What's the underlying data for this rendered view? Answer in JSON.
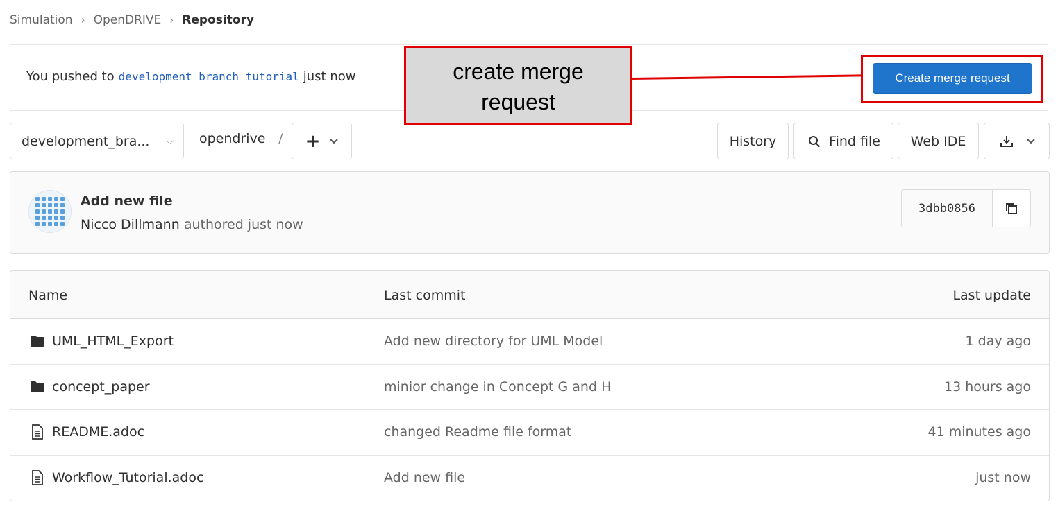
{
  "breadcrumb": {
    "items": [
      "Simulation",
      "OpenDRIVE"
    ],
    "current": "Repository"
  },
  "push_banner": {
    "prefix": "You pushed to",
    "branch": "development_branch_tutorial",
    "suffix": "just now",
    "button_label": "Create merge request"
  },
  "annotation": {
    "text_line1": "create merge",
    "text_line2": "request",
    "color": "#e00000"
  },
  "toolbar": {
    "branch": "development_bra...",
    "path": "opendrive",
    "path_separator": "/",
    "add_icon": "plus-icon",
    "history_label": "History",
    "find_file_label": "Find file",
    "web_ide_label": "Web IDE",
    "download_icon": "download-icon"
  },
  "commit": {
    "title": "Add new file",
    "author": "Nicco Dillmann",
    "meta": "authored just now",
    "sha": "3dbb0856",
    "copy_icon": "copy-icon"
  },
  "table": {
    "headers": {
      "name": "Name",
      "last_commit": "Last commit",
      "last_update": "Last update"
    },
    "rows": [
      {
        "type": "folder",
        "name": "UML_HTML_Export",
        "commit": "Add new directory for UML Model",
        "update": "1 day ago"
      },
      {
        "type": "folder",
        "name": "concept_paper",
        "commit": "minior change in Concept G and H",
        "update": "13 hours ago"
      },
      {
        "type": "file",
        "name": "README.adoc",
        "commit": "changed Readme file format",
        "update": "41 minutes ago"
      },
      {
        "type": "file",
        "name": "Workflow_Tutorial.adoc",
        "commit": "Add new file",
        "update": "just now"
      }
    ]
  },
  "colors": {
    "accent": "#1f75cb",
    "branch_link": "#1f5fb8",
    "highlight": "#e00000"
  }
}
